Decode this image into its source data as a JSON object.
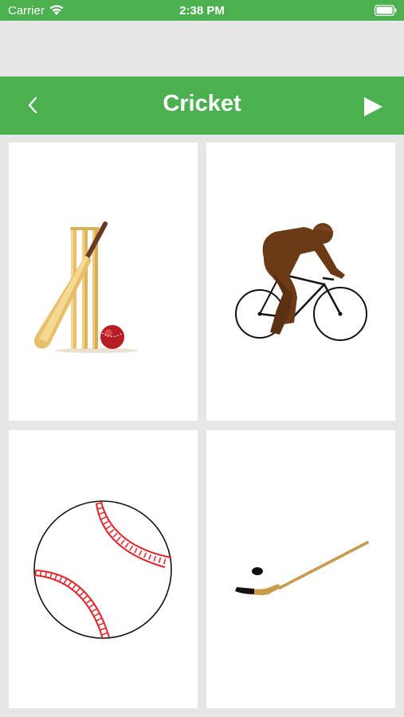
{
  "status_bar": {
    "carrier": "Carrier",
    "time": "2:38 PM"
  },
  "nav": {
    "title": "Cricket"
  },
  "cards": [
    {
      "name": "cricket"
    },
    {
      "name": "cycling"
    },
    {
      "name": "baseball"
    },
    {
      "name": "ice-hockey"
    }
  ],
  "colors": {
    "accent": "#4caf50",
    "background": "#e6e6e6",
    "card": "#ffffff"
  }
}
